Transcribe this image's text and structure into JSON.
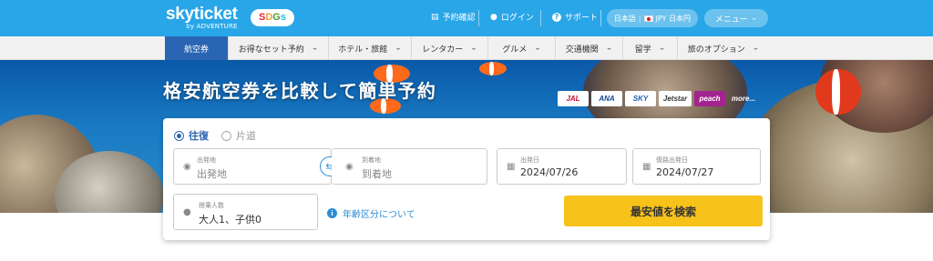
{
  "brand": {
    "logo_main": "skyticket",
    "logo_sub": "by ADVENTURE",
    "sdgs": [
      "S",
      "D",
      "G",
      "s",
      ""
    ]
  },
  "header": {
    "links": [
      {
        "label": "予約確認",
        "icon": "document-icon"
      },
      {
        "label": "ログイン",
        "icon": "user-icon"
      },
      {
        "label": "サポート",
        "icon": "question-icon"
      }
    ],
    "language_currency": {
      "language": "日本語",
      "currency": "JPY 日本円"
    },
    "menu_label": "メニュー"
  },
  "nav": {
    "items": [
      {
        "label": "航空券",
        "active": true
      },
      {
        "label": "お得なセット予約"
      },
      {
        "label": "ホテル・旅館"
      },
      {
        "label": "レンタカー"
      },
      {
        "label": "グルメ"
      },
      {
        "label": "交通機関"
      },
      {
        "label": "留学"
      },
      {
        "label": "旅のオプション"
      }
    ]
  },
  "hero": {
    "title": "格安航空券を比較して簡単予約",
    "airlines": [
      "JAL",
      "ANA",
      "SKY",
      "Jetstar",
      "peach",
      "more..."
    ]
  },
  "search": {
    "trip_types": [
      {
        "label": "往復",
        "selected": true
      },
      {
        "label": "片道",
        "selected": false
      }
    ],
    "origin": {
      "label": "出発地",
      "placeholder": "出発地"
    },
    "destination": {
      "label": "到着地",
      "placeholder": "到着地"
    },
    "depart_date": {
      "label": "出発日",
      "value": "2024/07/26"
    },
    "return_date": {
      "label": "復路出発日",
      "value": "2024/07/27"
    },
    "passengers": {
      "label": "搭乗人数",
      "value": "大人1、子供0"
    },
    "age_info_link": "年齢区分について",
    "search_button": "最安値を検索"
  },
  "colors": {
    "header_blue": "#29a6e8",
    "nav_active": "#2a65b3",
    "search_button": "#f7c21a",
    "link_blue": "#2a8cd6"
  }
}
